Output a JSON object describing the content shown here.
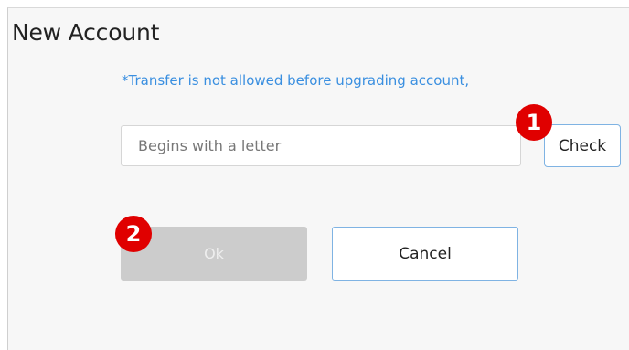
{
  "dialog": {
    "title": "New Account",
    "notice": "*Transfer is not allowed before upgrading account,",
    "name_input": {
      "value": "",
      "placeholder": "Begins with a letter"
    },
    "check_label": "Check",
    "ok_label": "Ok",
    "cancel_label": "Cancel"
  },
  "annotations": {
    "marker_1": "1",
    "marker_2": "2",
    "color": "#e00000"
  },
  "colors": {
    "accent_blue": "#3a8fe0",
    "disabled_gray": "#cccccc"
  }
}
